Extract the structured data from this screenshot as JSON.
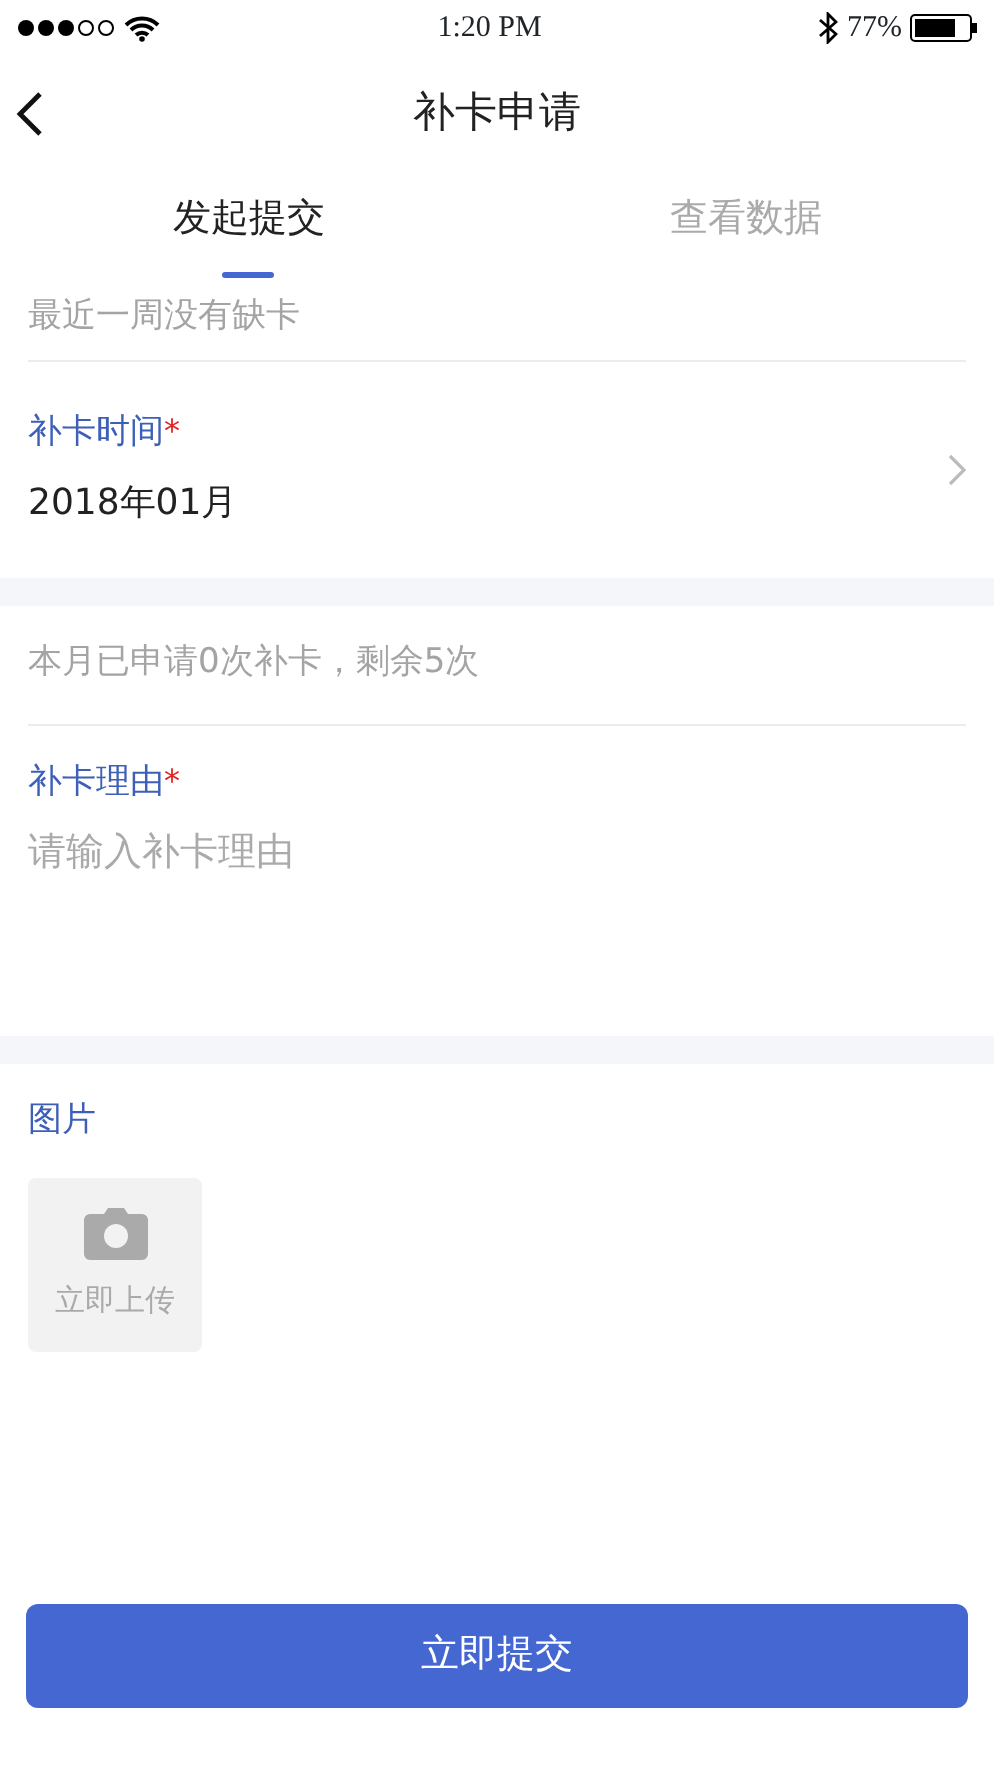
{
  "status_bar": {
    "time": "1:20 PM",
    "battery": "77%"
  },
  "nav": {
    "title": "补卡申请"
  },
  "tabs": [
    {
      "label": "发起提交",
      "selected": true
    },
    {
      "label": "查看数据",
      "selected": false
    }
  ],
  "notice_1": "最近一周没有缺卡",
  "time_field": {
    "label": "补卡时间",
    "required_mark": "*",
    "value": "2018年01月"
  },
  "notice_2": "本月已申请0次补卡，剩余5次",
  "reason_field": {
    "label": "补卡理由",
    "required_mark": "*",
    "placeholder": "请输入补卡理由"
  },
  "pictures": {
    "label": "图片",
    "upload_label": "立即上传"
  },
  "submit_button": "立即提交"
}
